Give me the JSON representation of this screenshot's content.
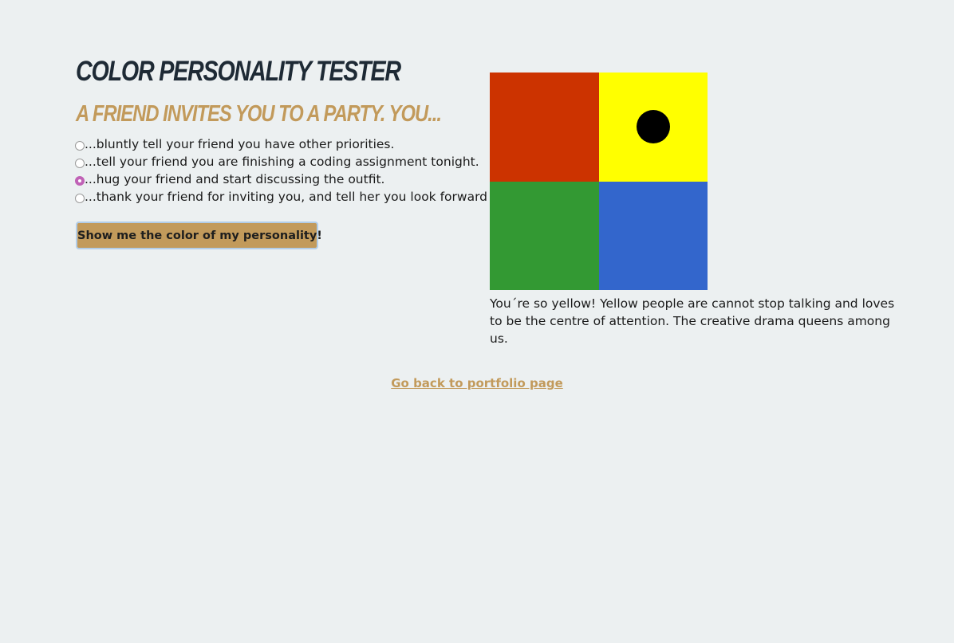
{
  "title": "Color Personality Tester",
  "question": "A friend invites you to a party. You...",
  "options": [
    {
      "label": "...bluntly tell your friend you have other priorities.",
      "checked": false
    },
    {
      "label": "...tell your friend you are finishing a coding assignment tonight.",
      "checked": false
    },
    {
      "label": "...hug your friend and start discussing the outfit.",
      "checked": true
    },
    {
      "label": "...thank your friend for inviting you, and tell her you look forward to it.",
      "checked": false
    }
  ],
  "submit_label": "Show me the color of my personality!",
  "color_grid": {
    "quadrants": [
      {
        "name": "red",
        "color": "#cc3300"
      },
      {
        "name": "yellow",
        "color": "#ffff00"
      },
      {
        "name": "green",
        "color": "#339933"
      },
      {
        "name": "blue",
        "color": "#3366cc"
      }
    ],
    "marker_quadrant": "yellow",
    "marker_color": "#000000"
  },
  "result_text": "You´re so yellow! Yellow people are cannot stop talking and loves to be the centre of attention. The creative drama queens among us.",
  "back_link": "Go back to portfolio page",
  "colors": {
    "background": "#ecf0f1",
    "accent": "#c29a5b",
    "radio_checked": "#c062b6",
    "title": "#1e2a35"
  }
}
